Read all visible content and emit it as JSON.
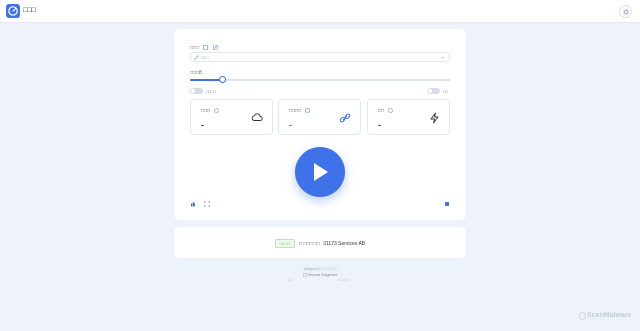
{
  "header": {
    "app_title": "□□□",
    "logo_icon": "speedometer-icon",
    "settings_icon": "gear-icon"
  },
  "form": {
    "url_label": "□□□",
    "url_placeholder": "□□□",
    "threads_label": "□□□8",
    "threads_value": 8,
    "threads_max": 64,
    "toggle_left_label": "□□□□",
    "toggle_right_label": "□□"
  },
  "stats": [
    {
      "label": "□□□",
      "value": "-",
      "icon": "cloud-icon"
    },
    {
      "label": "□□□□",
      "value": "-",
      "icon": "link-icon"
    },
    {
      "label": "□□",
      "value": "-",
      "icon": "lightning-icon"
    }
  ],
  "start_button_icon": "play-icon",
  "status": {
    "badge": "□□□□",
    "text": "□ □□□ □□",
    "isp": "31173 Services AB"
  },
  "footer": {
    "line1": "Wikipedi □ □ □□□□",
    "line2": "Secure Edgeone",
    "line3a": "□□",
    "line3b": "□□□□□□"
  },
  "watermark": "ScanMalware",
  "colors": {
    "accent": "#3f72e8",
    "background": "#eef3fb",
    "badge_green": "#4b9a3a"
  }
}
